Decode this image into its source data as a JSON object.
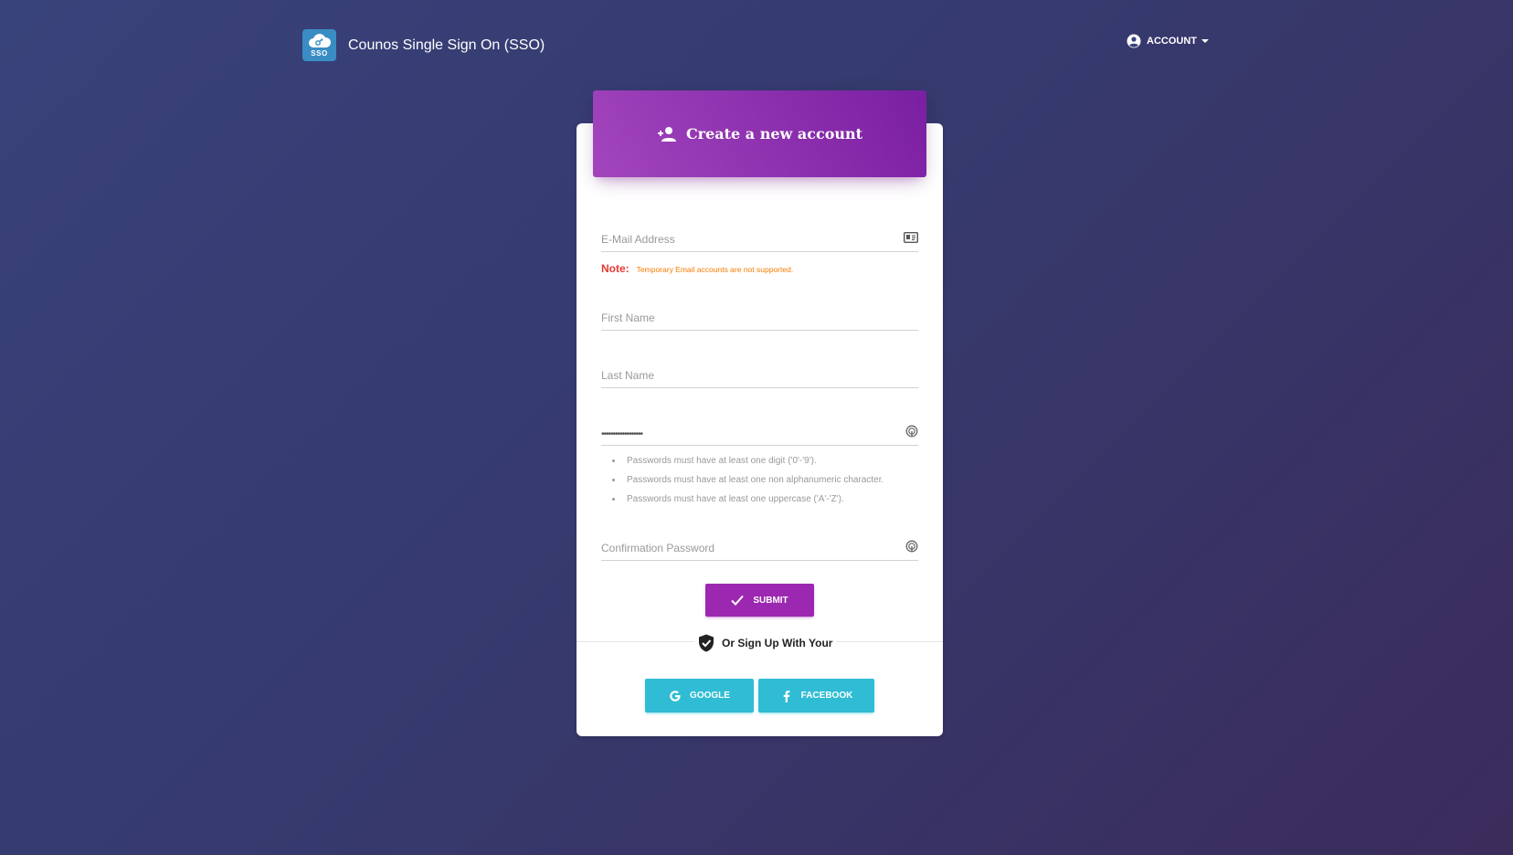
{
  "navbar": {
    "logo_text": "SSO",
    "title": "Counos Single Sign On (SSO)",
    "account_label": "ACCOUNT"
  },
  "card": {
    "header_title": "Create a new account",
    "email": {
      "placeholder": "E-Mail Address",
      "value": ""
    },
    "note": {
      "label": "Note:",
      "text": "Temporary Email accounts are not supported."
    },
    "first_name": {
      "placeholder": "First Name",
      "value": ""
    },
    "last_name": {
      "placeholder": "Last Name",
      "value": ""
    },
    "password": {
      "placeholder": "",
      "value": "••••••••••••••••••"
    },
    "password_rules": [
      "Passwords must have at least one digit ('0'-'9').",
      "Passwords must have at least one non alphanumeric character.",
      "Passwords must have at least one uppercase ('A'-'Z')."
    ],
    "confirm_password": {
      "placeholder": "Confirmation Password",
      "value": ""
    },
    "submit_label": "SUBMIT",
    "divider_text": "Or Sign Up With Your",
    "social": {
      "google_label": "GOOGLE",
      "facebook_label": "FACEBOOK"
    }
  },
  "colors": {
    "primary": "#9c27b0",
    "info": "#2fbcd4",
    "note_label": "#e53935",
    "note_text": "#f57c00",
    "brand_logo": "#3a8dc4"
  }
}
